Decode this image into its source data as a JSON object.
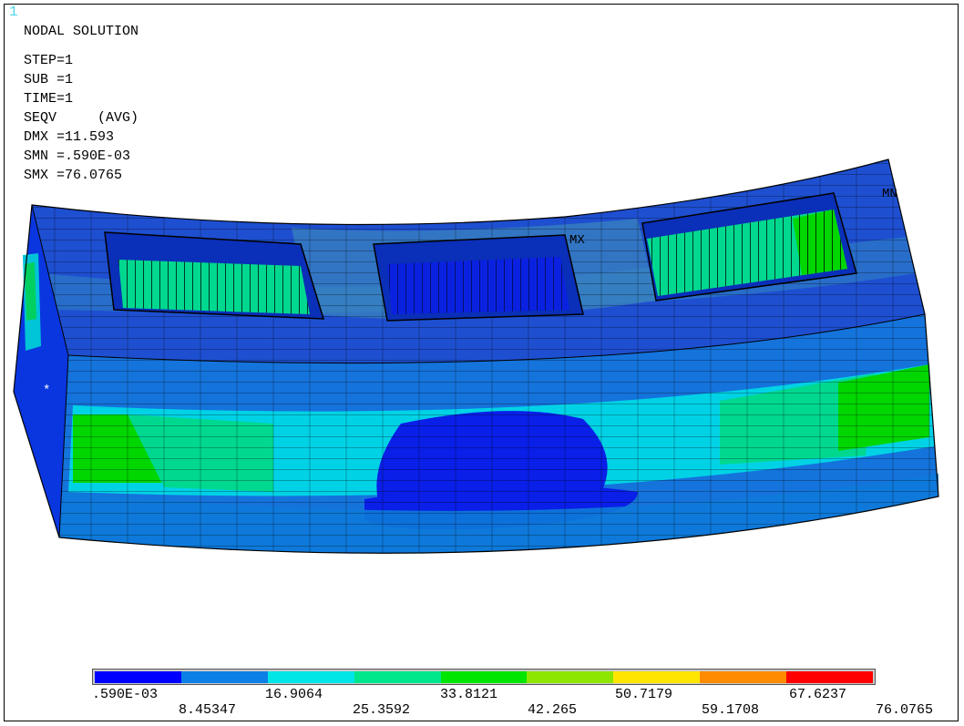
{
  "window_number": "1",
  "info": {
    "title": "NODAL SOLUTION",
    "step": "STEP=1",
    "sub": "SUB =1",
    "time": "TIME=1",
    "seqv": "SEQV     (AVG)",
    "dmx": "DMX =11.593",
    "smn": "SMN =.590E-03",
    "smx": "SMX =76.0765"
  },
  "markers": {
    "mx": "MX",
    "mn": "MN",
    "origin": "*"
  },
  "legend": {
    "colors": [
      "#0000ff",
      "#0d80e6",
      "#00e6e6",
      "#00e68c",
      "#00e600",
      "#8ce600",
      "#ffe600",
      "#ff8c00",
      "#ff0000"
    ],
    "labels_top": [
      ".590E-03",
      "16.9064",
      "33.8121",
      "50.7179",
      "67.6237"
    ],
    "labels_bottom": [
      "8.45347",
      "25.3592",
      "42.265",
      "59.1708",
      "76.0765"
    ]
  }
}
